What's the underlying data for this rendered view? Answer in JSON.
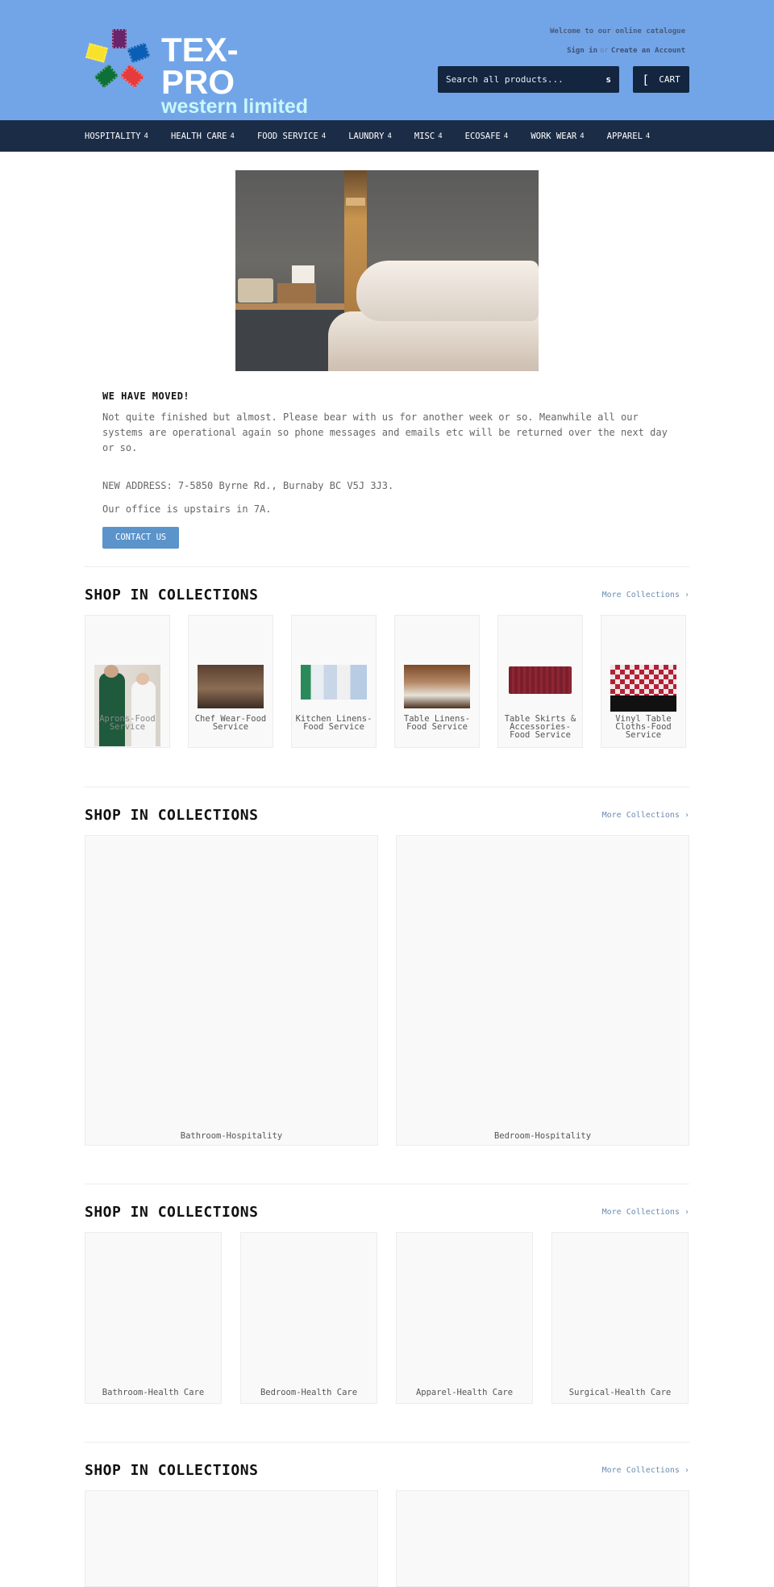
{
  "header": {
    "logo": {
      "title": "TEX-PRO",
      "subtitle": "western limited",
      "stamp_colors": [
        "#6a2469",
        "#f8e12a",
        "#0a5eb5",
        "#0d7038",
        "#e63b3c"
      ]
    },
    "welcome": "Welcome to our online catalogue",
    "sign_in": "Sign in",
    "or": "or",
    "create_account": "Create an Account",
    "search": {
      "placeholder": "Search all products...",
      "icon_glyph": "s"
    },
    "cart": {
      "icon_glyph": "[",
      "label": "CART"
    }
  },
  "nav": {
    "items": [
      {
        "label": "HOSPITALITY",
        "chev": "4"
      },
      {
        "label": "HEALTH CARE",
        "chev": "4"
      },
      {
        "label": "FOOD SERVICE",
        "chev": "4"
      },
      {
        "label": "LAUNDRY",
        "chev": "4"
      },
      {
        "label": "MISC",
        "chev": "4"
      },
      {
        "label": "ECOSAFE",
        "chev": "4"
      },
      {
        "label": "WORK WEAR",
        "chev": "4"
      },
      {
        "label": "APPAREL",
        "chev": "4"
      }
    ]
  },
  "notice": {
    "heading": "WE HAVE MOVED!",
    "body": "Not quite finished but almost. Please bear with us for another week or so. Meanwhile all our systems are operational again so phone messages and emails etc will be returned over the next day or so.",
    "address": "NEW ADDRESS: 7-5850 Byrne Rd., Burnaby BC V5J 3J3.",
    "office": "Our office is upstairs in 7A.",
    "contact_label": "CONTACT US"
  },
  "sections": [
    {
      "title": "SHOP IN COLLECTIONS",
      "more": "More Collections ›",
      "cards": [
        {
          "label": "Aprons-Food Service"
        },
        {
          "label": "Chef Wear-Food Service"
        },
        {
          "label": "Kitchen Linens-Food Service"
        },
        {
          "label": "Table Linens-Food Service"
        },
        {
          "label": "Table Skirts & Accessories-Food Service"
        },
        {
          "label": "Vinyl Table Cloths-Food Service"
        }
      ]
    },
    {
      "title": "SHOP IN COLLECTIONS",
      "more": "More Collections ›",
      "cards": [
        {
          "label": "Bathroom-Hospitality"
        },
        {
          "label": "Bedroom-Hospitality"
        }
      ]
    },
    {
      "title": "SHOP IN COLLECTIONS",
      "more": "More Collections ›",
      "cards": [
        {
          "label": "Bathroom-Health Care"
        },
        {
          "label": "Bedroom-Health Care"
        },
        {
          "label": "Apparel-Health Care"
        },
        {
          "label": "Surgical-Health Care"
        }
      ]
    },
    {
      "title": "SHOP IN COLLECTIONS",
      "more": "More Collections ›",
      "cards": []
    }
  ]
}
